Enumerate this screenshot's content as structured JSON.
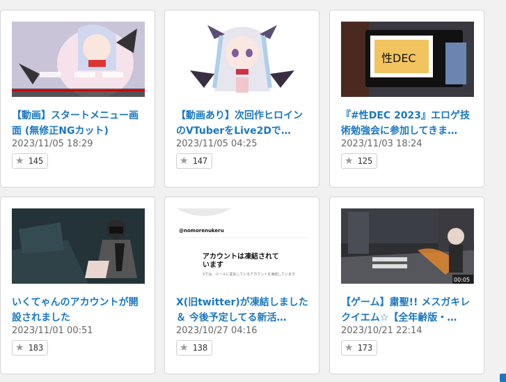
{
  "cards": [
    {
      "title": "【動画】スタートメニュー画面 (無修正NGカット)",
      "date": "2023/11/05 18:29",
      "likes": "145",
      "thumb_icon": "anime-girl-thumbnail"
    },
    {
      "title": "【動画あり】次回作ヒロインのVTuberをLive2Dで…",
      "date": "2023/11/05 04:25",
      "likes": "147",
      "thumb_icon": "anime-girl-thumbnail"
    },
    {
      "title": "『#性DEC 2023』エロゲ技術勉強会に参加してきま…",
      "date": "2023/11/03 18:24",
      "likes": "125",
      "thumb_icon": "event-sign-photo",
      "thumb_sign": "性DEC"
    },
    {
      "title": "いくてゃんのアカウントが開設されました",
      "date": "2023/11/01 00:51",
      "likes": "183",
      "thumb_icon": "anime-girl-thumbnail"
    },
    {
      "title": "X(旧twitter)が凍結しました ＆ 今後予定してる新活…",
      "date": "2023/10/27 04:16",
      "likes": "138",
      "thumb_icon": "suspended-account-screenshot",
      "thumb_handle": "@nomorenukeru",
      "thumb_heading": "アカウントは凍結されています",
      "thumb_sub": "Xでは、ルールに違反しているアカウントを凍結しています"
    },
    {
      "title": "【ゲーム】粛聖!! メスガキレクイエム☆【全年齢版・…",
      "date": "2023/10/21 22:14",
      "likes": "173",
      "thumb_icon": "game-screenshot",
      "thumb_time": "00:05"
    }
  ]
}
